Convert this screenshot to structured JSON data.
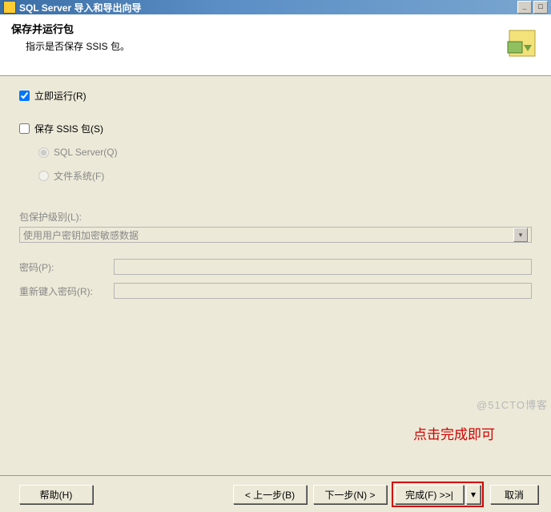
{
  "window": {
    "title": "SQL Server 导入和导出向导"
  },
  "header": {
    "title": "保存并运行包",
    "subtitle": "指示是否保存 SSIS 包。"
  },
  "options": {
    "run_now": {
      "label": "立即运行(R)",
      "checked": true
    },
    "save_ssis": {
      "label": "保存 SSIS 包(S)",
      "checked": false
    },
    "target_sql": {
      "label": "SQL Server(Q)"
    },
    "target_fs": {
      "label": "文件系统(F)"
    }
  },
  "protection": {
    "level_label": "包保护级别(L):",
    "level_value": "使用用户密钥加密敏感数据",
    "password_label": "密码(P):",
    "password_value": "",
    "password2_label": "重新键入密码(R):",
    "password2_value": ""
  },
  "annotation": "点击完成即可",
  "watermark": "@51CTO博客",
  "buttons": {
    "help": "帮助(H)",
    "back": "< 上一步(B)",
    "next": "下一步(N) >",
    "finish": "完成(F) >>|",
    "cancel": "取消"
  }
}
